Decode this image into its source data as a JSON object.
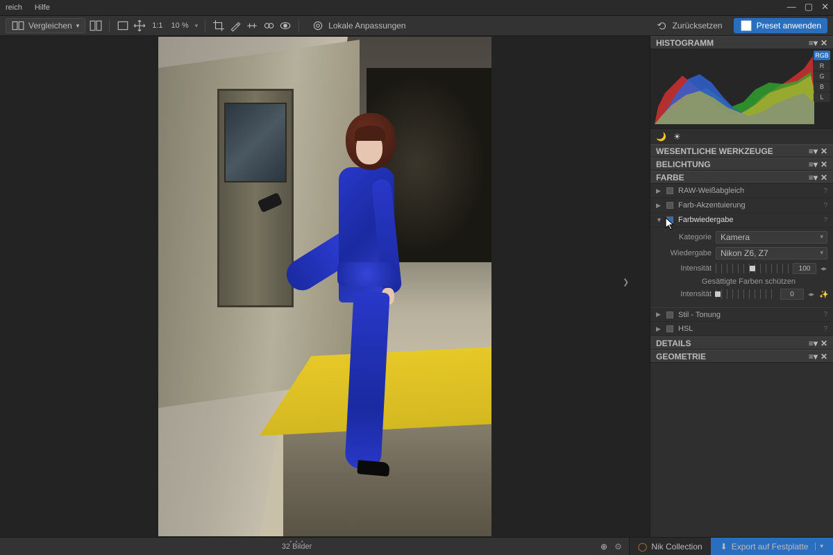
{
  "menu": {
    "reich": "reich",
    "help": "Hilfe"
  },
  "toolbar": {
    "compare": "Vergleichen",
    "ratio": "1:1",
    "zoom": "10 %",
    "local_adjust": "Lokale Anpassungen",
    "reset": "Zurücksetzen",
    "apply_preset": "Preset anwenden"
  },
  "histogram": {
    "title": "HISTOGRAMM",
    "channels": {
      "rgb": "RGB",
      "r": "R",
      "g": "G",
      "b": "B",
      "l": "L"
    }
  },
  "sections": {
    "tools": "WESENTLICHE WERKZEUGE",
    "exposure": "BELICHTUNG",
    "color": "FARBE",
    "details": "DETAILS",
    "geometry": "GEOMETRIE"
  },
  "color": {
    "raw_wb": "RAW-Weißabgleich",
    "accent": "Farb-Akzentuierung",
    "rendering": "Farbwiedergabe",
    "category_label": "Kategorie",
    "category_value": "Kamera",
    "render_label": "Wiedergabe",
    "render_value": "Nikon Z6, Z7",
    "intensity_label": "Intensität",
    "intensity1_value": "100",
    "protect": "Gesättigte Farben schützen",
    "intensity2_value": "0",
    "style": "Stil - Tonung",
    "hsl": "HSL"
  },
  "status": {
    "count": "32 Bilder",
    "nik": "Nik Collection",
    "export": "Export auf Festplatte"
  }
}
